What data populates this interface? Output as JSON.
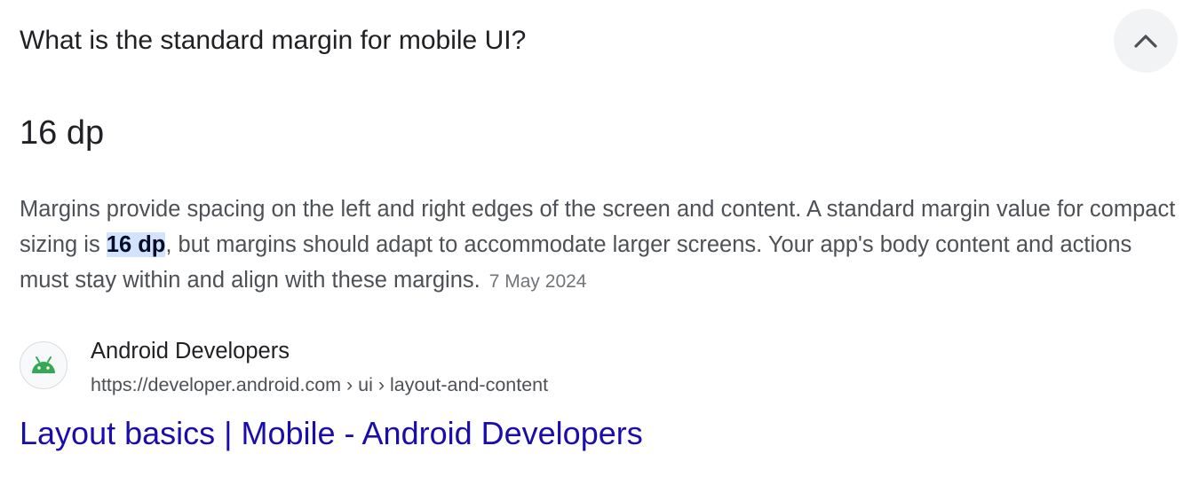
{
  "question": "What is the standard margin for mobile UI?",
  "collapse_icon": "chevron-up-icon",
  "answer": "16 dp",
  "snippet": {
    "before": "Margins provide spacing on the left and right edges of the screen and content. A standard margin value for compact sizing is ",
    "highlight": "16 dp",
    "after": ", but margins should adapt to accommodate larger screens. Your app's body content and actions must stay within and align with these margins.",
    "date": "7 May 2024"
  },
  "source": {
    "favicon_icon": "android-icon",
    "name": "Android Developers",
    "url": "https://developer.android.com › ui › layout-and-content"
  },
  "result_title": "Layout basics | Mobile - Android Developers",
  "colors": {
    "link": "#1a0dab",
    "highlight_bg": "#d3e3fd",
    "android_green": "#34a853"
  }
}
